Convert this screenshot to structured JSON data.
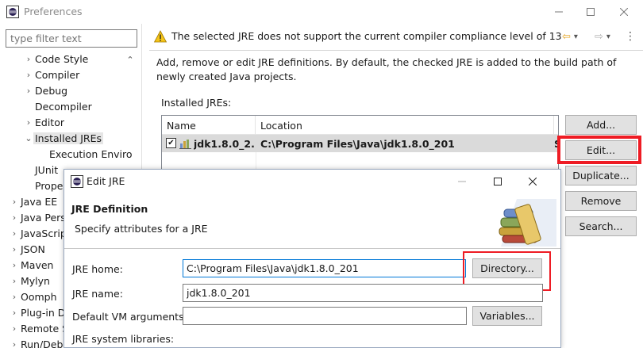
{
  "window": {
    "title": "Preferences",
    "filter_placeholder": "type filter text"
  },
  "tree": {
    "items": [
      {
        "label": "Code Style",
        "arrow": "›"
      },
      {
        "label": "Compiler",
        "arrow": "›"
      },
      {
        "label": "Debug",
        "arrow": "›"
      },
      {
        "label": "Decompiler",
        "arrow": ""
      },
      {
        "label": "Editor",
        "arrow": "›"
      },
      {
        "label": "Installed JREs",
        "arrow": "⌄"
      },
      {
        "label": "Execution Enviro",
        "arrow": ""
      },
      {
        "label": "JUnit",
        "arrow": ""
      },
      {
        "label": "Prope",
        "arrow": ""
      },
      {
        "label": "Java EE",
        "arrow": "›"
      },
      {
        "label": "Java Pers",
        "arrow": "›"
      },
      {
        "label": "JavaScrip",
        "arrow": "›"
      },
      {
        "label": "JSON",
        "arrow": "›"
      },
      {
        "label": "Maven",
        "arrow": "›"
      },
      {
        "label": "Mylyn",
        "arrow": "›"
      },
      {
        "label": "Oomph",
        "arrow": "›"
      },
      {
        "label": "Plug-in D",
        "arrow": "›"
      },
      {
        "label": "Remote S",
        "arrow": "›"
      },
      {
        "label": "Run/Deb",
        "arrow": "›"
      }
    ]
  },
  "message": {
    "text": "The selected JRE does not support the current compiler compliance level of 13"
  },
  "page": {
    "description": "Add, remove or edit JRE definitions. By default, the checked JRE is added to the build path of newly created Java projects.",
    "installed_label": "Installed JREs:",
    "columns": [
      "Name",
      "Location",
      "T"
    ],
    "rows": [
      {
        "name": "jdk1.8.0_2...",
        "location": "C:\\Program Files\\Java\\jdk1.8.0_201",
        "type": "S",
        "checked": true
      }
    ],
    "buttons": {
      "add": "Add...",
      "edit": "Edit...",
      "duplicate": "Duplicate...",
      "remove": "Remove",
      "search": "Search..."
    }
  },
  "dialog": {
    "title": "Edit JRE",
    "header_title": "JRE Definition",
    "header_subtitle": "Specify attributes for a JRE",
    "jre_home_label": "JRE home:",
    "jre_home_value": "C:\\Program Files\\Java\\jdk1.8.0_201",
    "directory_button": "Directory...",
    "jre_name_label": "JRE name:",
    "jre_name_value": "jdk1.8.0_201",
    "vm_args_label": "Default VM arguments:",
    "vm_args_value": "",
    "variables_button": "Variables...",
    "libraries_label": "JRE system libraries:"
  },
  "colors": {
    "highlight": "#ee1c24",
    "selected_row": "#dadada",
    "button_face": "#e1e1e1"
  }
}
